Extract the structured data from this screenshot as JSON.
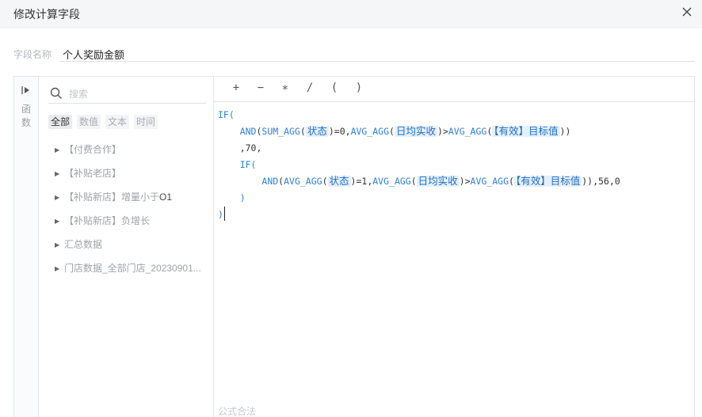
{
  "dialog": {
    "title": "修改计算字段",
    "close_icon": "close-icon"
  },
  "field_name": {
    "label": "字段名称",
    "value": "个人奖励金额"
  },
  "rail": {
    "label": "函数",
    "collapse_icon": "collapse-arrow-icon"
  },
  "search": {
    "placeholder": "搜索"
  },
  "filters": [
    "全部",
    "数值",
    "文本",
    "时间"
  ],
  "tree": [
    {
      "label": "【付费合作】"
    },
    {
      "label": "【补贴老店】"
    },
    {
      "label_a": "【补贴新店】",
      "label_b": "增量小于",
      "label_c": "O1"
    },
    {
      "label": "【补贴新店】负增长"
    },
    {
      "label": "汇总数据"
    },
    {
      "label": "门店数据_全部门店_20230901..."
    }
  ],
  "toolbar": {
    "ops": [
      "+",
      "−",
      "∗",
      "/",
      "(",
      ")"
    ]
  },
  "formula": {
    "if": "IF(",
    "and": "AND",
    "sum_agg": "SUM_AGG",
    "avg_agg": "AVG_AGG",
    "f_status": "状态",
    "f_daily": "日均实收",
    "f_target": "【有效】目标值",
    "v70": ",70,",
    "v_eq0": "=0,",
    "v_eq1": "=1,",
    "v_gt": ">",
    "v_tail": "),56,0",
    "close": ")"
  },
  "status": "公式合法"
}
